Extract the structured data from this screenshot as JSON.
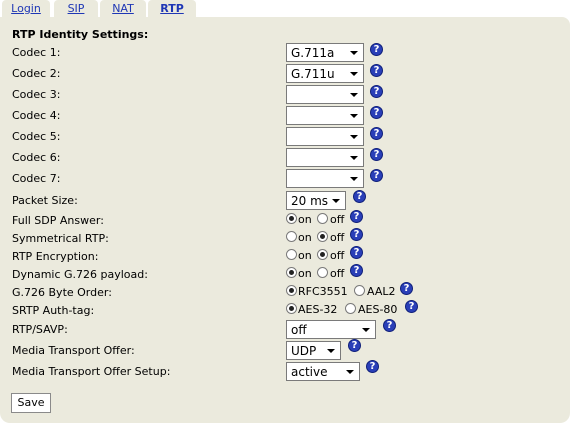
{
  "tabs": [
    {
      "label": "Login"
    },
    {
      "label": "SIP"
    },
    {
      "label": "NAT"
    },
    {
      "label": "RTP",
      "active": true
    }
  ],
  "section_title": "RTP Identity Settings:",
  "codecs": [
    {
      "label": "Codec 1:",
      "value": "G.711a"
    },
    {
      "label": "Codec 2:",
      "value": "G.711u"
    },
    {
      "label": "Codec 3:",
      "value": ""
    },
    {
      "label": "Codec 4:",
      "value": ""
    },
    {
      "label": "Codec 5:",
      "value": ""
    },
    {
      "label": "Codec 6:",
      "value": ""
    },
    {
      "label": "Codec 7:",
      "value": ""
    }
  ],
  "packet_size": {
    "label": "Packet Size:",
    "value": "20 ms"
  },
  "full_sdp": {
    "label": "Full SDP Answer:",
    "opt1": "on",
    "opt2": "off",
    "selected": "on"
  },
  "symmetrical_rtp": {
    "label": "Symmetrical RTP:",
    "opt1": "on",
    "opt2": "off",
    "selected": "off"
  },
  "rtp_encryption": {
    "label": "RTP Encryption:",
    "opt1": "on",
    "opt2": "off",
    "selected": "off"
  },
  "dynamic_g726": {
    "label": "Dynamic G.726 payload:",
    "opt1": "on",
    "opt2": "off",
    "selected": "on"
  },
  "g726_byte_order": {
    "label": "G.726 Byte Order:",
    "opt1": "RFC3551",
    "opt2": "AAL2",
    "selected": "RFC3551"
  },
  "srtp_auth_tag": {
    "label": "SRTP Auth-tag:",
    "opt1": "AES-32",
    "opt2": "AES-80",
    "selected": "AES-32"
  },
  "rtp_savp": {
    "label": "RTP/SAVP:",
    "value": "off"
  },
  "media_transport_offer": {
    "label": "Media Transport Offer:",
    "value": "UDP"
  },
  "media_transport_offer_setup": {
    "label": "Media Transport Offer Setup:",
    "value": "active"
  },
  "help_glyph": "?",
  "save_label": "Save"
}
